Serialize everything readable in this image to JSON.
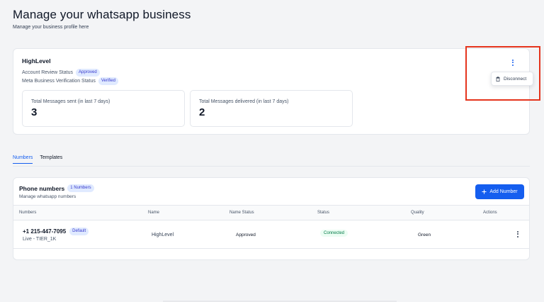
{
  "header": {
    "title": "Manage your whatsapp business",
    "subtitle": "Manage your business profile here"
  },
  "business": {
    "name": "HighLevel",
    "account_review_label": "Account Review Status",
    "account_review_badge": "Approved",
    "meta_verification_label": "Meta Business Verification Status",
    "meta_verification_badge": "Verified",
    "stats": [
      {
        "label": "Total Messages sent (in last 7 days)",
        "value": "3"
      },
      {
        "label": "Total Messages delivered (in last 7 days)",
        "value": "2"
      }
    ],
    "menu": {
      "disconnect_label": "Disconnect"
    }
  },
  "tabs": [
    {
      "label": "Numbers",
      "active": true
    },
    {
      "label": "Templates",
      "active": false
    }
  ],
  "phone_numbers": {
    "title": "Phone numbers",
    "count_badge": "1 Numbers",
    "subtitle": "Manage whatsapp numbers",
    "add_button_label": "Add Number",
    "columns": [
      "Numbers",
      "Name",
      "Name Status",
      "Status",
      "Quality",
      "Actions"
    ],
    "rows": [
      {
        "number": "+1 215-447-7095",
        "default_badge": "Default",
        "tier": "Live - TIER_1K",
        "name": "HighLevel",
        "name_status": "Approved",
        "status": "Connected",
        "quality": "Green"
      }
    ]
  },
  "colors": {
    "accent": "#155eef",
    "badge_bg": "#e0eaff",
    "connected_bg": "#ecfdf3",
    "connected_text": "#027a48",
    "highlight_box": "#e5341d"
  },
  "icons": [
    "kebab-menu-icon",
    "trash-icon",
    "plus-icon"
  ]
}
